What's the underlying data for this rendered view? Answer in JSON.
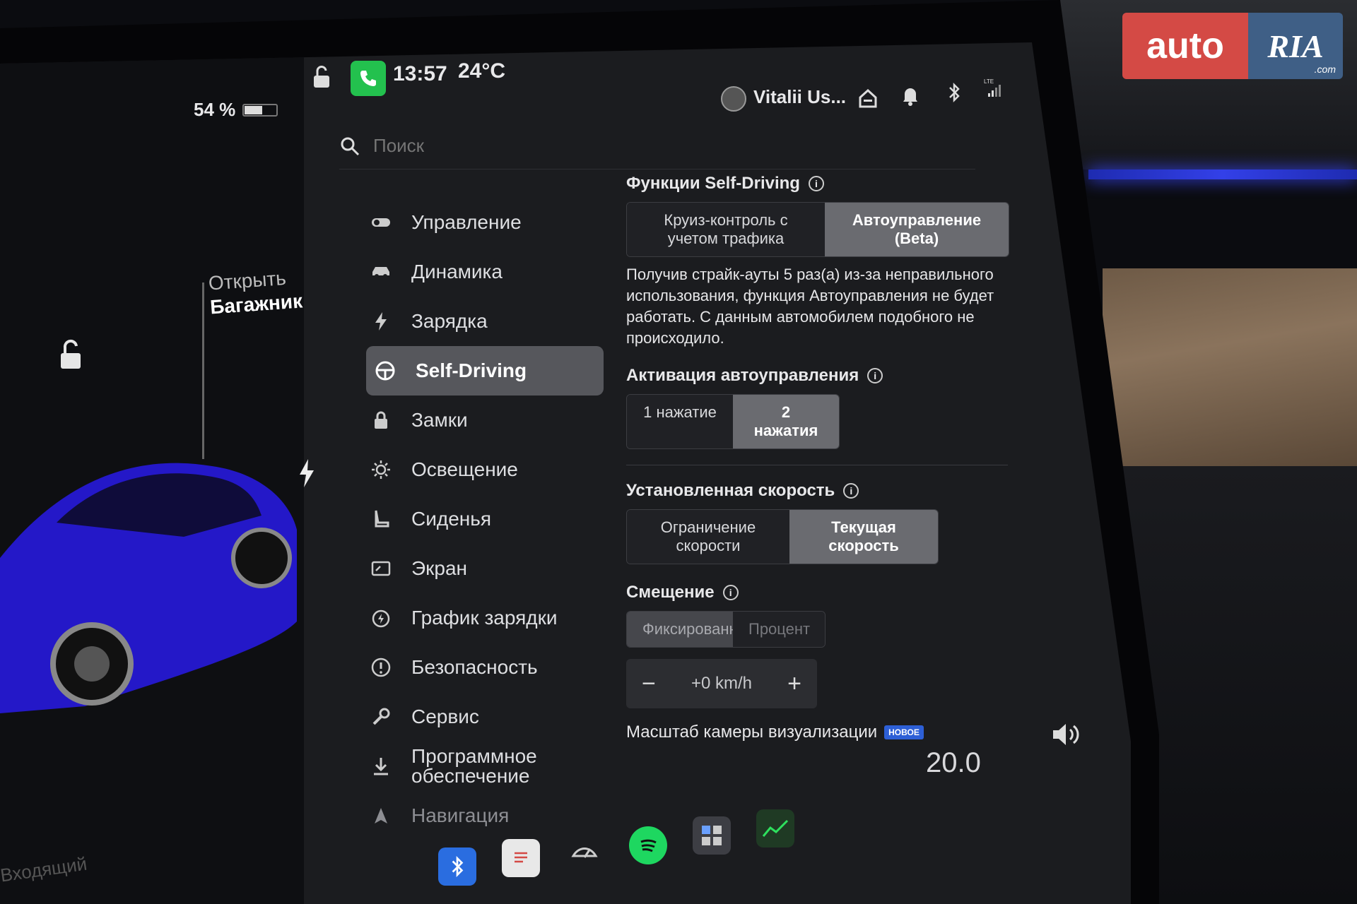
{
  "watermark": {
    "auto": "auto",
    "ria": "RIA",
    "com": ".com"
  },
  "colors": {
    "accent_blue": "#2d5fd6",
    "phone_green": "#23c14e",
    "active_bg": "#56575c",
    "brand_red": "#d44a45",
    "brand_blue": "#3f5f86"
  },
  "car_panel": {
    "battery": "54 %",
    "battery_level": 0.54,
    "trunk_line1": "Открыть",
    "trunk_line2": "Багажник",
    "incoming": "Входящий"
  },
  "status_bar": {
    "time": "13:57",
    "temperature": "24°C",
    "user_name": "Vitalii Us...",
    "icons": [
      "lock-open-icon",
      "phone-icon",
      "home-icon",
      "bell-icon",
      "bluetooth-icon",
      "lte-signal-icon"
    ]
  },
  "search": {
    "placeholder": "Поиск"
  },
  "sidebar": {
    "items": [
      {
        "label": "Управление",
        "icon": "toggle-icon"
      },
      {
        "label": "Динамика",
        "icon": "car-icon"
      },
      {
        "label": "Зарядка",
        "icon": "bolt-icon"
      },
      {
        "label": "Self-Driving",
        "icon": "steering-wheel-icon",
        "active": true
      },
      {
        "label": "Замки",
        "icon": "lock-icon"
      },
      {
        "label": "Освещение",
        "icon": "sun-icon"
      },
      {
        "label": "Сиденья",
        "icon": "seat-icon"
      },
      {
        "label": "Экран",
        "icon": "screen-icon"
      },
      {
        "label": "График зарядки",
        "icon": "clock-bolt-icon"
      },
      {
        "label": "Безопасность",
        "icon": "alert-icon"
      },
      {
        "label": "Сервис",
        "icon": "wrench-icon"
      },
      {
        "label": "Программное обеспечение",
        "icon": "download-icon"
      },
      {
        "label": "Навигация",
        "icon": "navigation-icon"
      }
    ]
  },
  "content": {
    "self_driving": {
      "title": "Функции Self-Driving",
      "option_a": "Круиз-контроль с учетом трафика",
      "option_b": "Автоуправление (Beta)",
      "warning": "Получив страйк-ауты 5 раз(а) из-за неправильного использования, функция Автоуправления не будет работать. С данным автомобилем подобного не происходило."
    },
    "activation": {
      "title": "Активация автоуправления",
      "option_a": "1 нажатие",
      "option_b": "2 нажатия"
    },
    "set_speed": {
      "title": "Установленная скорость",
      "option_a": "Ограничение скорости",
      "option_b": "Текущая скорость"
    },
    "offset": {
      "title": "Смещение",
      "option_a": "Фиксированно",
      "option_b": "Процент",
      "value": "+0 km/h",
      "minus": "−",
      "plus": "+"
    },
    "camera": {
      "label": "Масштаб камеры визуализации",
      "badge": "НОВОЕ"
    }
  },
  "bottom": {
    "zoom_value": "20.0"
  },
  "dock": {
    "icons": [
      "phone-icon",
      "bluetooth-icon",
      "notepad-icon",
      "wiper-icon",
      "spotify-icon",
      "apps-icon",
      "stocks-icon"
    ]
  }
}
